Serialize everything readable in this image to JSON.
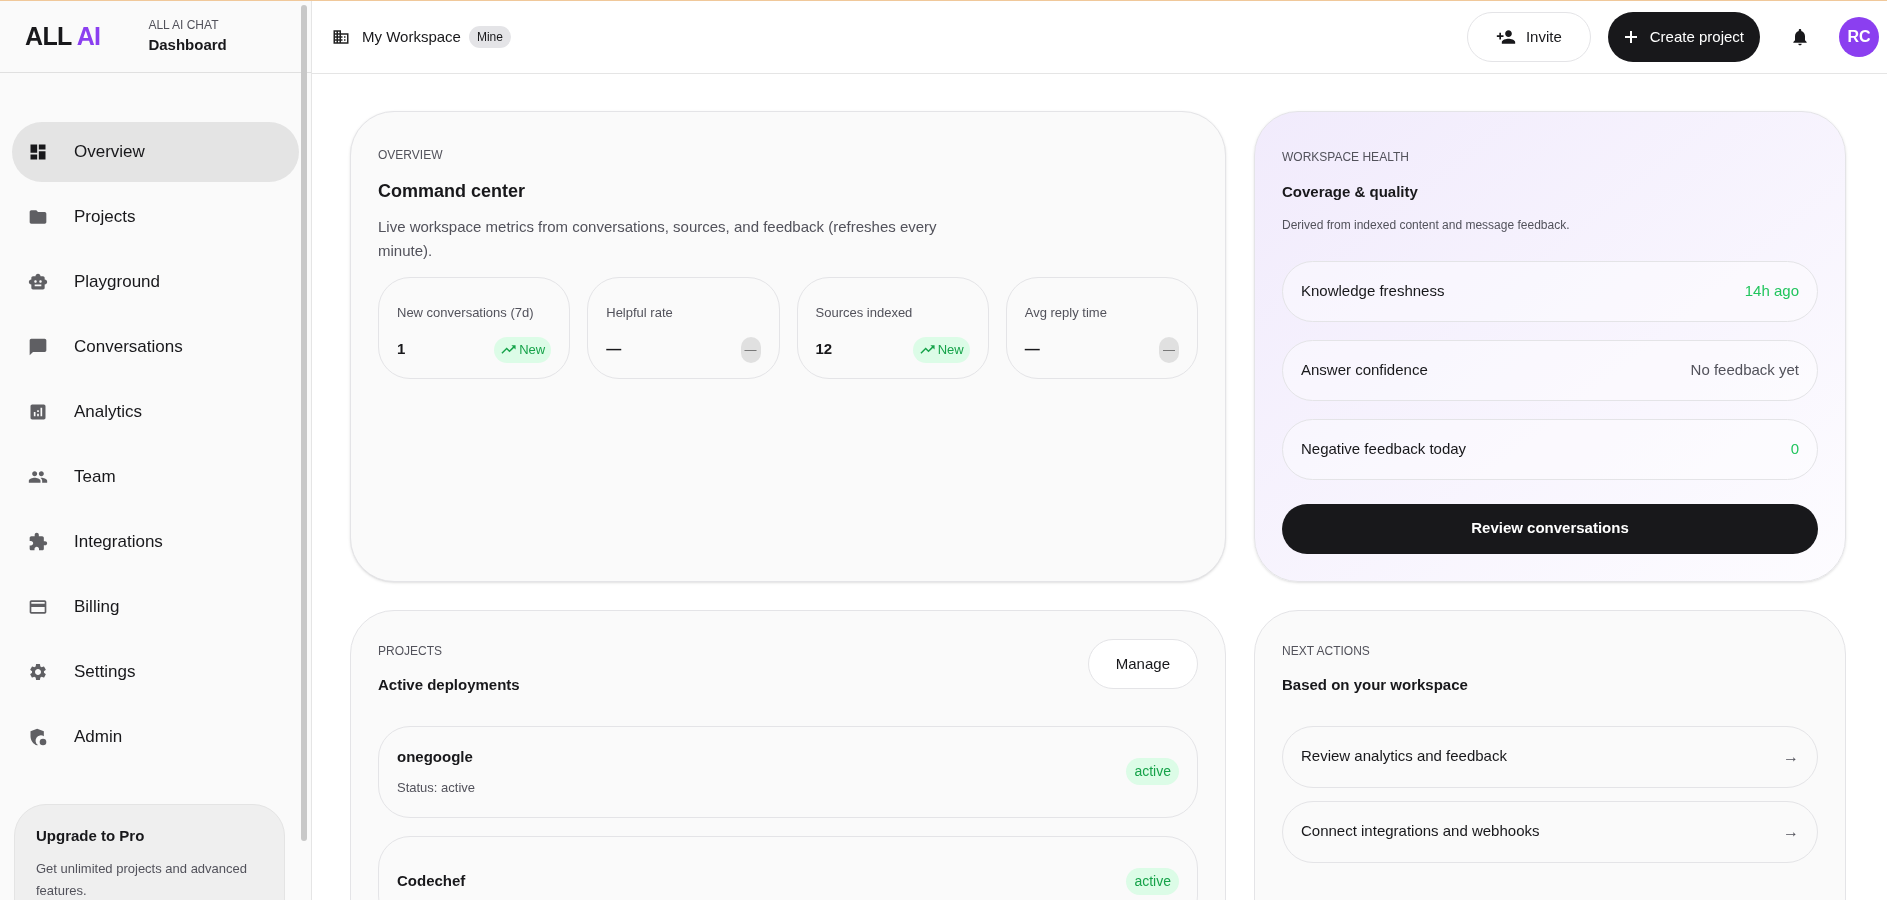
{
  "brand": {
    "logo_main": "ALL",
    "logo_accent": "AI",
    "app_label": "ALL AI CHAT",
    "page_label": "Dashboard"
  },
  "sidebar": {
    "items": [
      {
        "label": "Overview",
        "kind": "dashboard",
        "selected": true
      },
      {
        "label": "Projects",
        "kind": "folder",
        "selected": false
      },
      {
        "label": "Playground",
        "kind": "robot",
        "selected": false
      },
      {
        "label": "Conversations",
        "kind": "chat",
        "selected": false
      },
      {
        "label": "Analytics",
        "kind": "chart",
        "selected": false
      },
      {
        "label": "Team",
        "kind": "people",
        "selected": false
      },
      {
        "label": "Integrations",
        "kind": "puzzle",
        "selected": false
      },
      {
        "label": "Billing",
        "kind": "card",
        "selected": false
      },
      {
        "label": "Settings",
        "kind": "gear",
        "selected": false
      },
      {
        "label": "Admin",
        "kind": "shield",
        "selected": false
      }
    ],
    "upgrade": {
      "title": "Upgrade to Pro",
      "text": "Get unlimited projects and advanced features."
    }
  },
  "header": {
    "workspace": "My Workspace",
    "badge": "Mine",
    "invite": "Invite",
    "create": "Create project",
    "avatar": "RC"
  },
  "overview": {
    "eyebrow": "OVERVIEW",
    "title": "Command center",
    "description": "Live workspace metrics from conversations, sources, and feedback (refreshes every minute).",
    "metrics": [
      {
        "label": "New conversations (7d)",
        "value": "1",
        "kind": "trend",
        "badge": "New"
      },
      {
        "label": "Helpful rate",
        "value": "—",
        "kind": "neutral",
        "badge": "—"
      },
      {
        "label": "Sources indexed",
        "value": "12",
        "kind": "trend",
        "badge": "New"
      },
      {
        "label": "Avg reply time",
        "value": "—",
        "kind": "neutral",
        "badge": "—"
      }
    ]
  },
  "health": {
    "eyebrow": "WORKSPACE HEALTH",
    "title": "Coverage & quality",
    "description": "Derived from indexed content and message feedback.",
    "rows": [
      {
        "label": "Knowledge freshness",
        "value": "14h ago",
        "kind": "good"
      },
      {
        "label": "Answer confidence",
        "value": "No feedback yet",
        "kind": "neutral"
      },
      {
        "label": "Negative feedback today",
        "value": "0",
        "kind": "good"
      }
    ],
    "button": "Review conversations"
  },
  "projects": {
    "eyebrow": "PROJECTS",
    "title": "Active deployments",
    "button": "Manage",
    "items": [
      {
        "name": "onegoogle",
        "status": "Status: active",
        "badge": "active"
      },
      {
        "name": "Codechef",
        "badge": "active"
      }
    ]
  },
  "next_actions": {
    "eyebrow": "NEXT ACTIONS",
    "title": "Based on your workspace",
    "items": [
      {
        "label": "Review analytics and feedback",
        "arrow": "→"
      },
      {
        "label": "Connect integrations and webhooks",
        "arrow": "→"
      }
    ]
  }
}
